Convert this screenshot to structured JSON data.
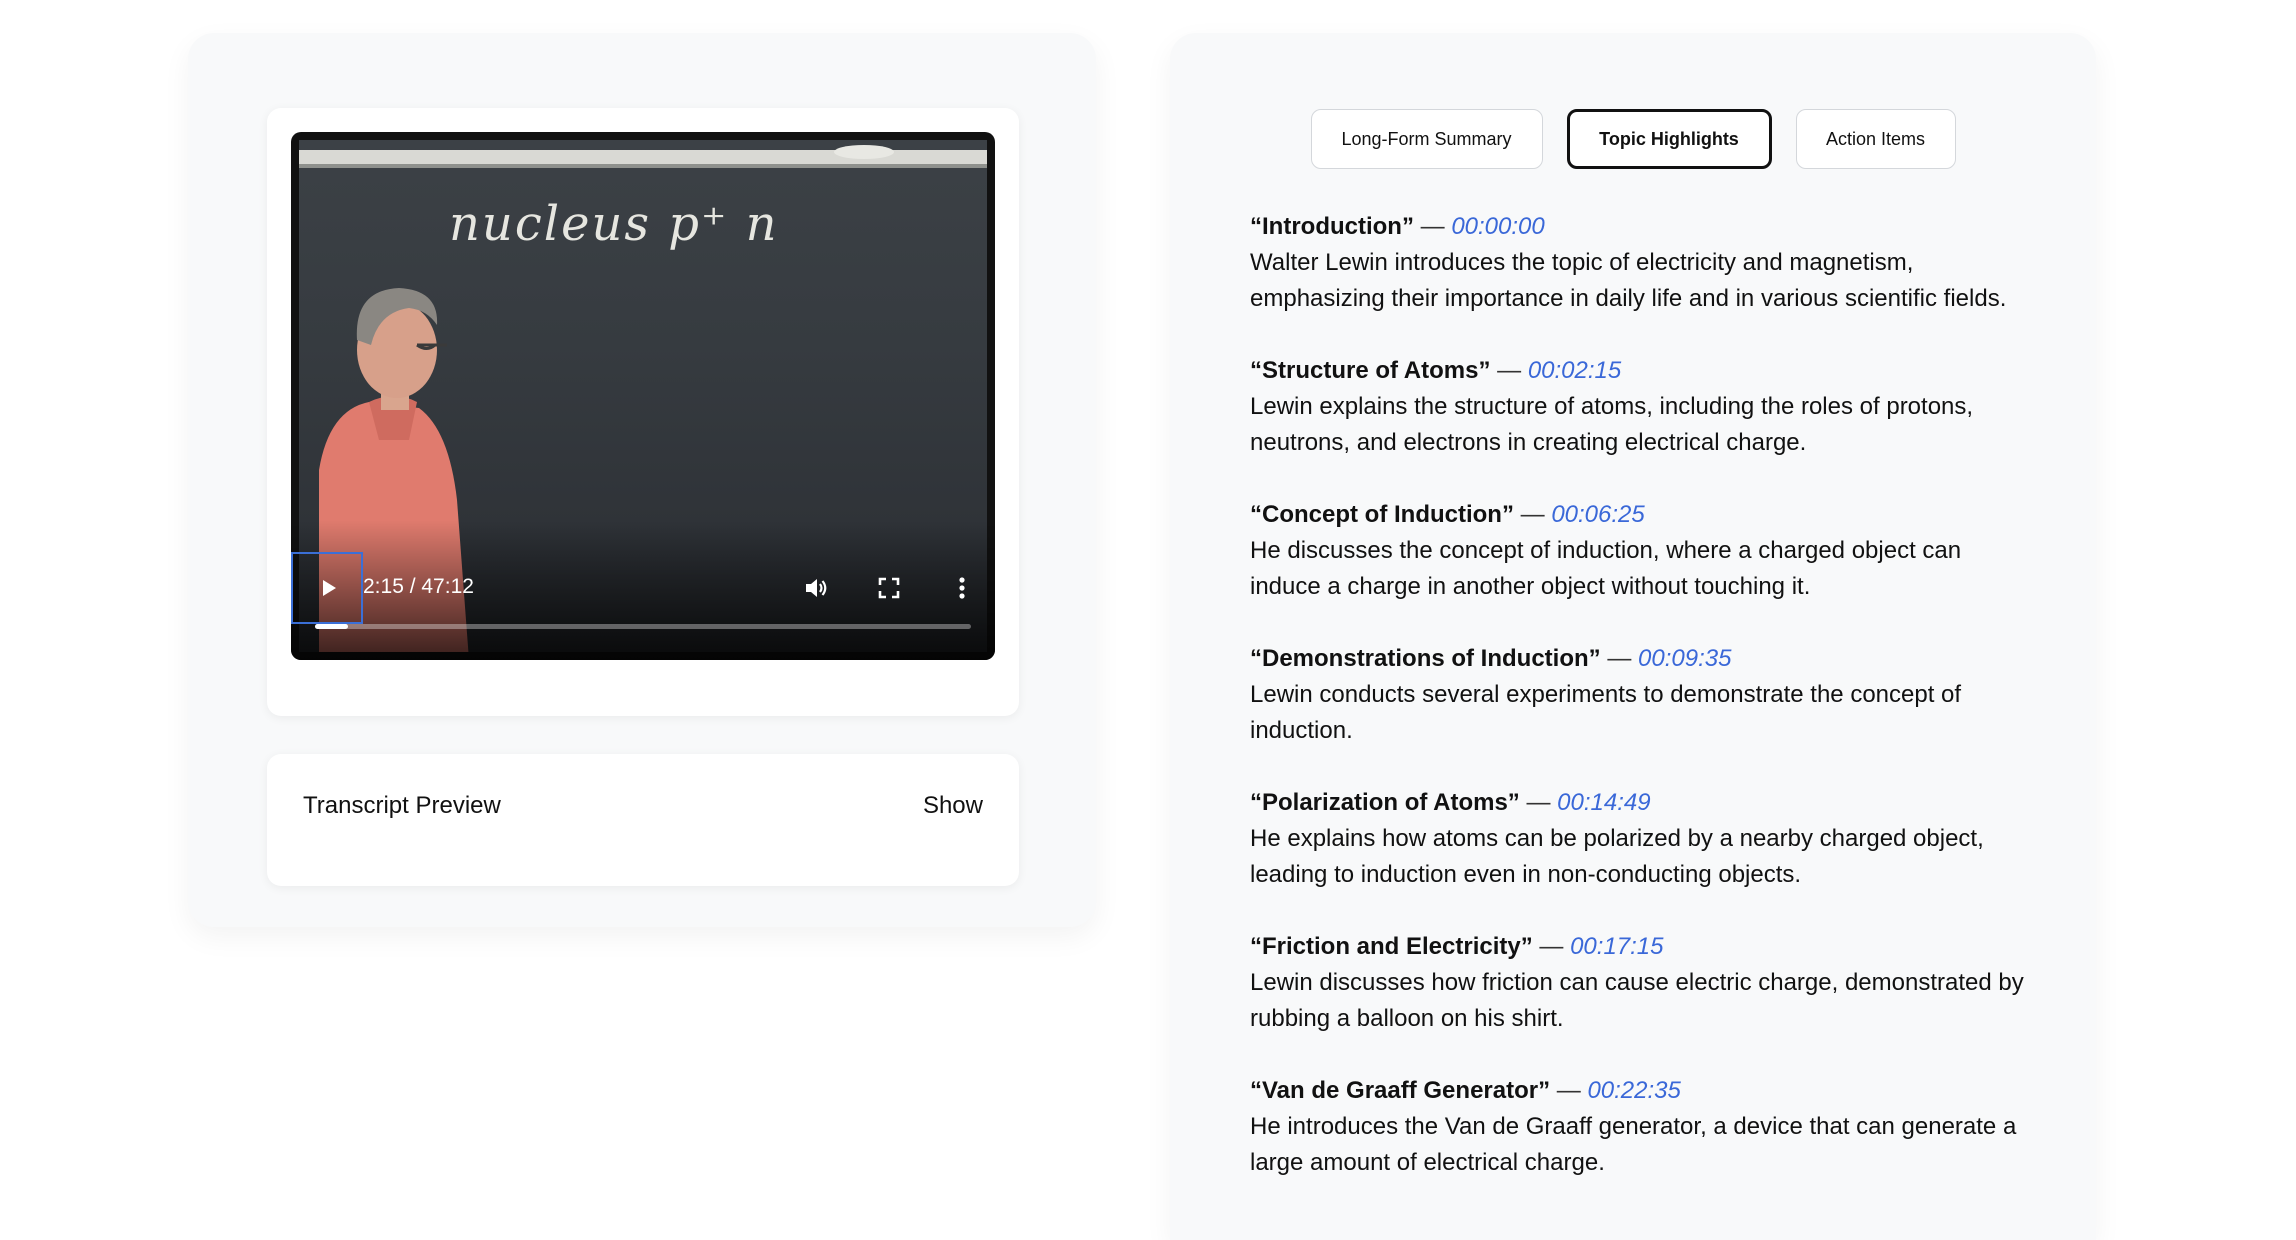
{
  "video": {
    "time_display": "2:15 / 47:12",
    "progress": 0.05,
    "chalkboard_text": "nucleus p⁺ n",
    "icons": {
      "play": "play-icon",
      "volume": "volume-icon",
      "fullscreen": "fullscreen-icon",
      "more": "more-options-icon"
    }
  },
  "transcript": {
    "title": "Transcript Preview",
    "toggle_label": "Show"
  },
  "tabs": [
    {
      "label": "Long-Form Summary",
      "active": false
    },
    {
      "label": "Topic Highlights",
      "active": true
    },
    {
      "label": "Action Items",
      "active": false
    }
  ],
  "highlights": [
    {
      "title": "“Introduction”",
      "dash": "—",
      "time": "00:00:00",
      "desc": "Walter Lewin introduces the topic of electricity and magnetism, emphasizing their importance in daily life and in various scientific fields."
    },
    {
      "title": "“Structure of Atoms”",
      "dash": "—",
      "time": "00:02:15",
      "desc": "Lewin explains the structure of atoms, including the roles of protons, neutrons, and electrons in creating electrical charge."
    },
    {
      "title": "“Concept of Induction”",
      "dash": "—",
      "time": "00:06:25",
      "desc": "He discusses the concept of induction, where a charged object can induce a charge in another object without touching it."
    },
    {
      "title": "“Demonstrations of Induction”",
      "dash": "—",
      "time": "00:09:35",
      "desc": "Lewin conducts several experiments to demonstrate the concept of induction."
    },
    {
      "title": "“Polarization of Atoms”",
      "dash": "—",
      "time": "00:14:49",
      "desc": "He explains how atoms can be polarized by a nearby charged object, leading to induction even in non-conducting objects."
    },
    {
      "title": "“Friction and Electricity”",
      "dash": "—",
      "time": "00:17:15",
      "desc": "Lewin discusses how friction can cause electric charge, demonstrated by rubbing a balloon on his shirt."
    },
    {
      "title": "“Van de Graaff Generator”",
      "dash": "—",
      "time": "00:22:35",
      "desc": "He introduces the Van de Graaff generator, a device that can generate a large amount of electrical charge."
    }
  ],
  "colors": {
    "timestamp": "#3a68d8",
    "panel_bg": "#f8f9fa",
    "focus_ring": "#3b6fd6"
  }
}
